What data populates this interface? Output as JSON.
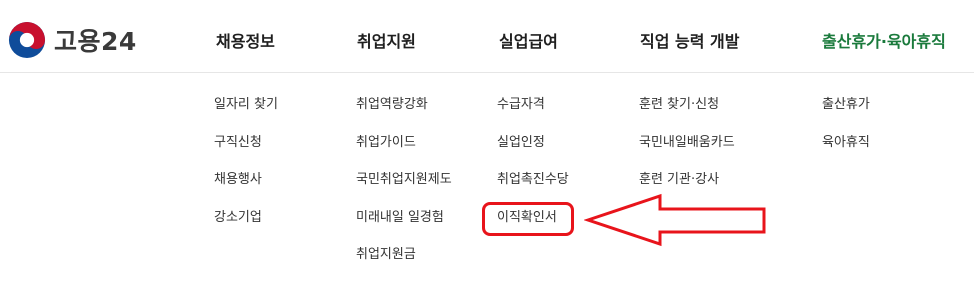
{
  "logo": {
    "text": "고용24",
    "emblem_icon": "taegeuk-emblem-icon",
    "colors": {
      "red": "#c8102e",
      "blue": "#0f4c9a"
    }
  },
  "nav": {
    "items": [
      {
        "label": "채용정보"
      },
      {
        "label": "취업지원"
      },
      {
        "label": "실업급여"
      },
      {
        "label": "직업 능력 개발"
      },
      {
        "label": "출산휴가·육아휴직",
        "color": "#1a7a3c"
      }
    ]
  },
  "submenus": {
    "job_info": [
      "일자리 찾기",
      "구직신청",
      "채용행사",
      "강소기업"
    ],
    "employment_support": [
      "취업역량강화",
      "취업가이드",
      "국민취업지원제도",
      "미래내일 일경험",
      "취업지원금"
    ],
    "unemployment_benefits": [
      "수급자격",
      "실업인정",
      "취업촉진수당",
      "이직확인서"
    ],
    "vocational_training": [
      "훈련 찾기·신청",
      "국민내일배움카드",
      "훈련 기관·강사"
    ],
    "maternity_leave": [
      "출산휴가",
      "육아휴직"
    ]
  },
  "annotation": {
    "color": "#e8141b",
    "target": "이직확인서"
  }
}
